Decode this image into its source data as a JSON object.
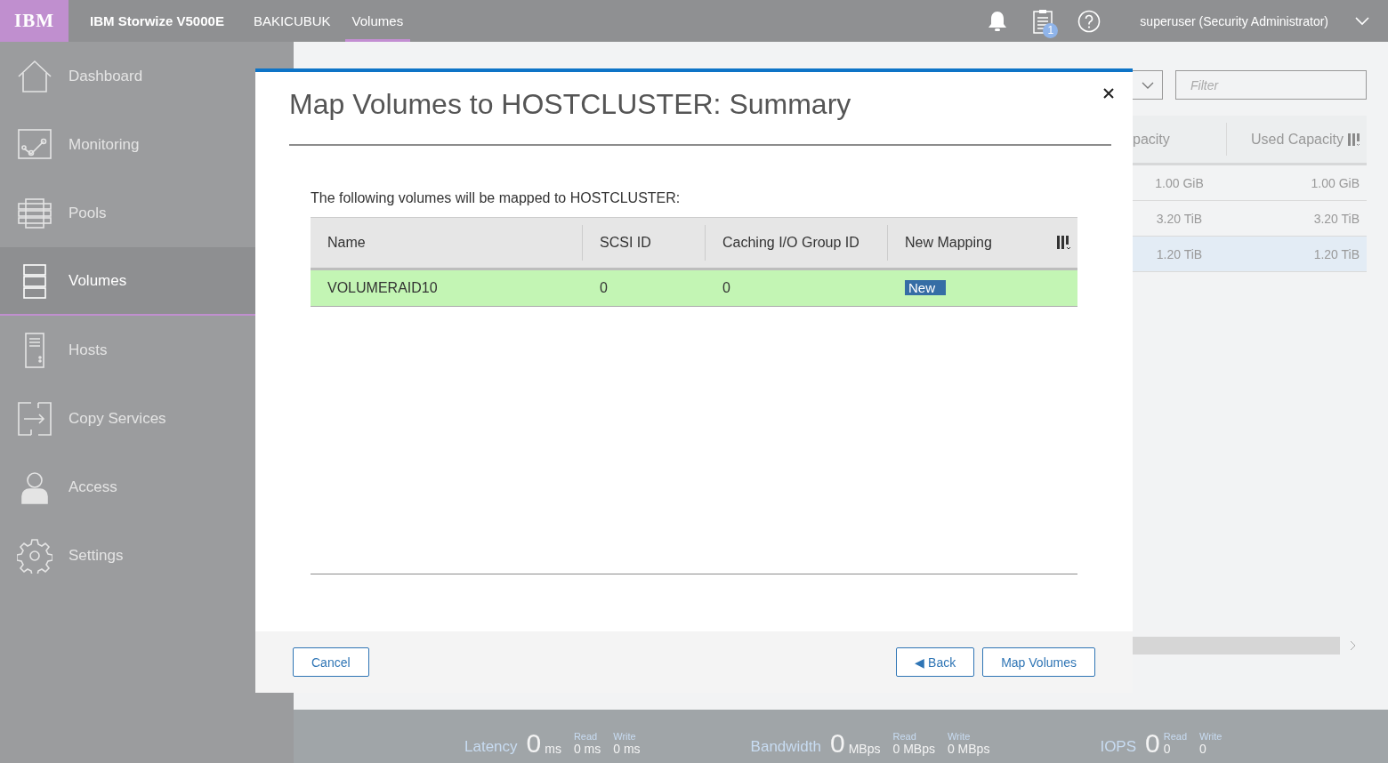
{
  "header": {
    "logo": "IBM",
    "product": "IBM Storwize V5000E",
    "breadcrumbs": [
      {
        "label": "BAKICUBUK",
        "selected": false
      },
      {
        "label": "Volumes",
        "selected": true
      }
    ],
    "task_badge": "1",
    "user": "superuser (Security Administrator)"
  },
  "sidebar": {
    "items": [
      {
        "label": "Dashboard",
        "kind": "house",
        "selected": false
      },
      {
        "label": "Monitoring",
        "kind": "graph",
        "selected": false
      },
      {
        "label": "Pools",
        "kind": "pools",
        "selected": false
      },
      {
        "label": "Volumes",
        "kind": "volumes",
        "selected": true
      },
      {
        "label": "Hosts",
        "kind": "hosts",
        "selected": false
      },
      {
        "label": "Copy Services",
        "kind": "copy",
        "selected": false
      },
      {
        "label": "Access",
        "kind": "person",
        "selected": false
      },
      {
        "label": "Settings",
        "kind": "gear",
        "selected": false
      }
    ]
  },
  "background_table": {
    "filter_placeholder": "Filter",
    "columns": [
      "pacity",
      "Used Capacity"
    ],
    "rows": [
      {
        "cells": [
          "1.00 GiB",
          "1.00 GiB"
        ],
        "selected": false
      },
      {
        "cells": [
          "3.20 TiB",
          "3.20 TiB"
        ],
        "selected": false
      },
      {
        "cells": [
          "1.20 TiB",
          "1.20 TiB"
        ],
        "selected": true
      }
    ]
  },
  "dialog": {
    "title": "Map Volumes to HOSTCLUSTER: Summary",
    "intro": "The following volumes will be mapped to HOSTCLUSTER:",
    "columns": [
      "Name",
      "SCSI ID",
      "Caching I/O Group ID",
      "New Mapping"
    ],
    "rows": [
      {
        "name": "VOLUMERAID10",
        "scsi_id": "0",
        "io_group_id": "0",
        "mapping": "New",
        "is_new": true
      }
    ],
    "cancel": "Cancel",
    "back": "◀ Back",
    "confirm": "Map Volumes"
  },
  "status_bar": {
    "metrics": [
      {
        "label": "Latency",
        "value": "0",
        "unit": "ms",
        "read_label": "Read",
        "read": "0 ms",
        "write_label": "Write",
        "write": "0 ms"
      },
      {
        "label": "Bandwidth",
        "value": "0",
        "unit": "MBps",
        "read_label": "Read",
        "read": "0 MBps",
        "write_label": "Write",
        "write": "0 MBps"
      },
      {
        "label": "IOPS",
        "value": "0",
        "read_label": "Read",
        "read": "0",
        "write_label": "Write",
        "write": "0"
      }
    ]
  }
}
